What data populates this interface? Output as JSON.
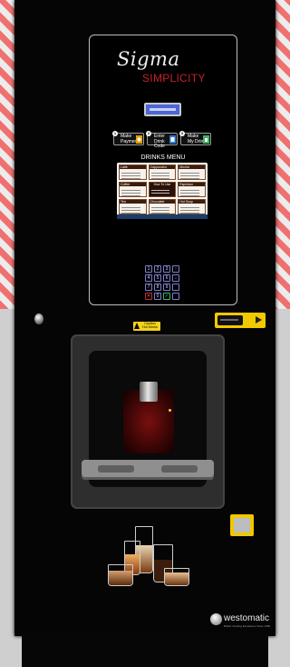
{
  "brand": {
    "name_part1": "Sigma",
    "name_part2": "SIMPLICITY",
    "accent_color": "#c8202a"
  },
  "steps": [
    {
      "number": "1",
      "line1": "Make",
      "line2": "Payment",
      "icon": "coin-icon",
      "color": "#e8a000"
    },
    {
      "number": "2",
      "line1": "Enter",
      "line2": "Drink Code",
      "icon": "keypad-icon",
      "color": "#2a7bd4"
    },
    {
      "number": "3",
      "line1": "Make",
      "line2": "My Drink",
      "icon": "cup-icon",
      "color": "#3cb464"
    }
  ],
  "menu": {
    "title": "DRINKS MENU",
    "cards": [
      "Latte",
      "Cappuccino",
      "Mocha",
      "Coffee",
      "How To Use",
      "Espresso",
      "Tea",
      "Chocolate",
      "Hot Soup"
    ]
  },
  "keypad": {
    "keys": [
      "1",
      "2",
      "3",
      "↑",
      "4",
      "5",
      "6",
      "↓",
      "7",
      "8",
      "9",
      "",
      "✕",
      "0",
      "✓",
      ""
    ]
  },
  "caution": {
    "line1": "Caution",
    "line2": "Hot Drinks"
  },
  "footer_logo": {
    "name": "westomatic",
    "tagline": "British Vending Excellence Since 1966"
  }
}
